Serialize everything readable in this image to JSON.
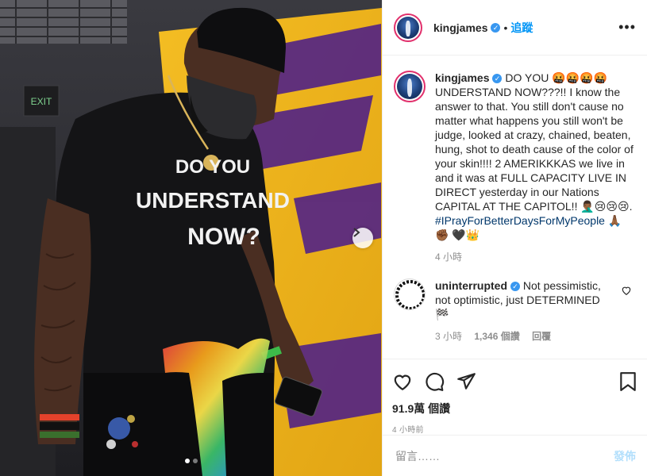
{
  "post": {
    "username": "kingjames",
    "verified_mark": "✓",
    "follow_label": "追蹤",
    "more_label": "•••",
    "caption_text": "DO YOU 🤬🤬🤬🤬 UNDERSTAND NOW???!! I know the answer to that. You still don't cause no matter what happens you still won't be judge, looked at crazy, chained, beaten, hung, shot to death cause of the color of your skin!!!! 2 AMERIKKKAS we live in and it was at FULL CAPACITY LIVE IN DIRECT yesterday in our Nations CAPITAL AT THE CAPITOL!! 🤦🏾‍♂️😢😢😢.",
    "caption_hashtag": "#IPrayForBetterDaysForMyPeople",
    "caption_tail": "🙏🏾✊🏾 🖤👑",
    "caption_time": "4 小時"
  },
  "shirt_text": {
    "line1": "DO YOU",
    "line2": "UNDERSTAND",
    "line3": "NOW?"
  },
  "exit_sign": "EXIT",
  "comment": {
    "username": "uninterrupted",
    "text": "Not pessimistic, not optimistic, just DETERMINED 🏁",
    "time": "3 小時",
    "likes": "1,346 個讚",
    "reply_label": "回覆"
  },
  "stats": {
    "views_count": "91.9萬",
    "views_label": "個讚",
    "posted": "4 小時前"
  },
  "add_comment": {
    "placeholder": "留言……",
    "post_label": "發佈"
  },
  "carousel": {
    "total": 2,
    "active": 1
  },
  "icons": {
    "like": "heart-icon",
    "comment": "comment-bubble-icon",
    "share": "paper-plane-icon",
    "save": "bookmark-icon",
    "next": "chevron-right-icon",
    "comment_like": "heart-outline-icon"
  },
  "colors": {
    "link_blue": "#0095f6",
    "hashtag": "#00376b",
    "muted": "#8e8e8e",
    "post_btn_disabled": "#b2dffc",
    "lakers_gold": "#f2b81c",
    "lakers_purple": "#552583"
  }
}
